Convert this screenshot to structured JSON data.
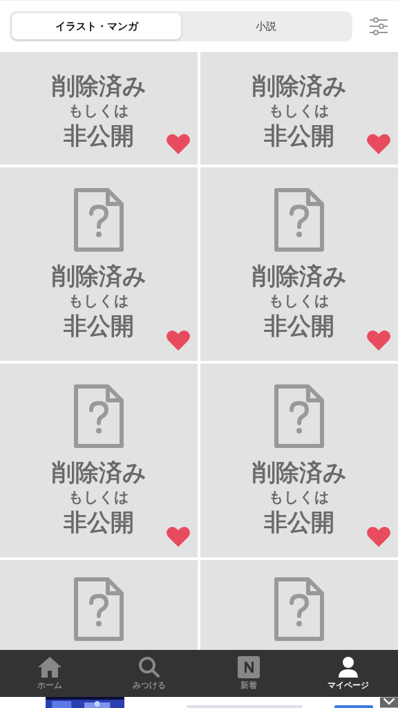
{
  "tabs": [
    {
      "label": "イラスト・マンガ",
      "selected": true
    },
    {
      "label": "小説",
      "selected": false
    }
  ],
  "rows": [
    {
      "kind": "clipped_top",
      "tiles": [
        {
          "title": "削除済み",
          "subtitle": "もしくは",
          "status": "非公開",
          "liked": true
        },
        {
          "title": "削除済み",
          "subtitle": "もしくは",
          "status": "非公開",
          "liked": true
        }
      ]
    },
    {
      "kind": "full",
      "tiles": [
        {
          "title": "削除済み",
          "subtitle": "もしくは",
          "status": "非公開",
          "liked": true
        },
        {
          "title": "削除済み",
          "subtitle": "もしくは",
          "status": "非公開",
          "liked": true
        }
      ]
    },
    {
      "kind": "full",
      "tiles": [
        {
          "title": "削除済み",
          "subtitle": "もしくは",
          "status": "非公開",
          "liked": true
        },
        {
          "title": "削除済み",
          "subtitle": "もしくは",
          "status": "非公開",
          "liked": true
        }
      ]
    },
    {
      "kind": "clipped_bottom",
      "tiles": [
        {
          "kind": "unavailable"
        },
        {
          "kind": "unavailable"
        }
      ]
    }
  ],
  "nav": [
    {
      "kind": "home",
      "label": "ホーム",
      "selected": false
    },
    {
      "kind": "search",
      "label": "みつける",
      "selected": false
    },
    {
      "kind": "new",
      "label": "新着",
      "selected": false
    },
    {
      "kind": "user",
      "label": "マイページ",
      "selected": true
    }
  ]
}
